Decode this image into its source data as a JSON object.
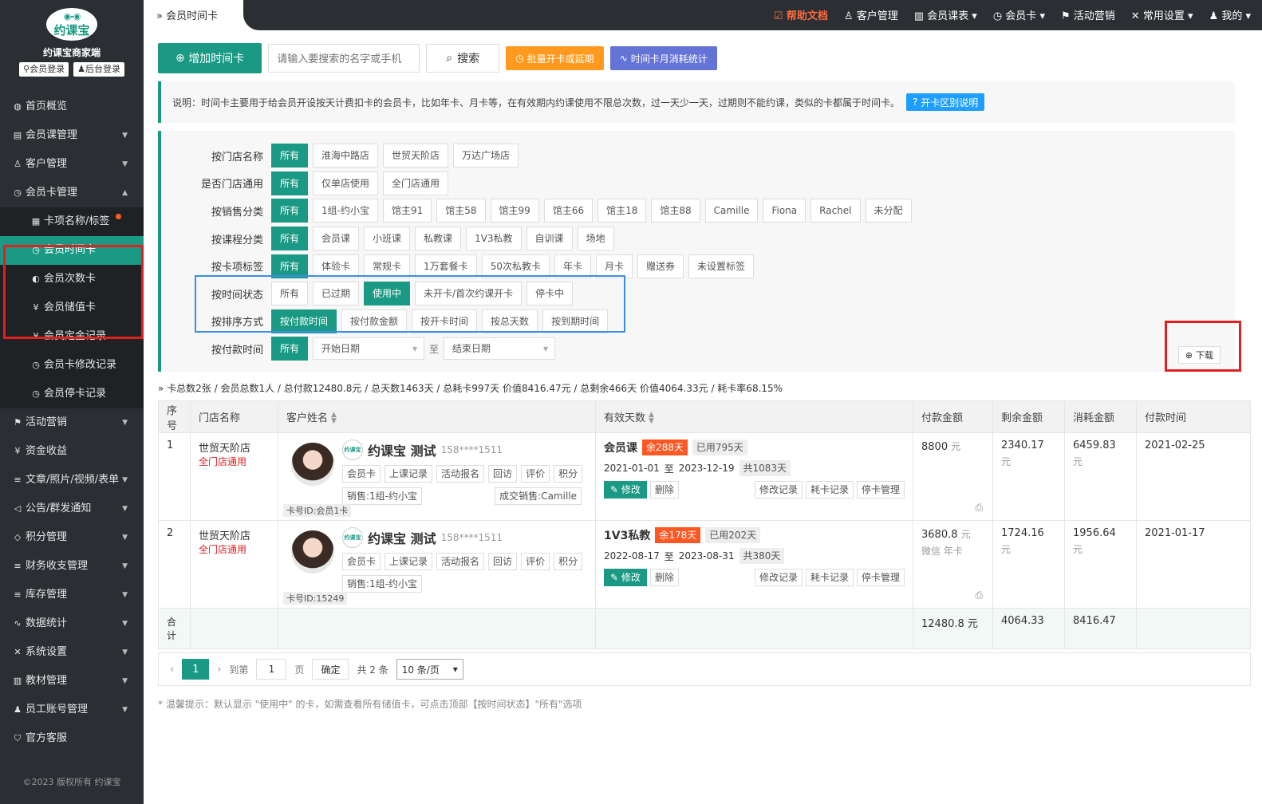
{
  "brand": {
    "logo_text": "约课宝",
    "shop_name": "约课宝商家端",
    "member_login": "会员登录",
    "admin_login": "后台登录"
  },
  "sidebar": {
    "items": [
      {
        "label": "首页概览",
        "icon": "globe-icon"
      },
      {
        "label": "会员课管理",
        "icon": "doc-icon"
      },
      {
        "label": "客户管理",
        "icon": "user-icon"
      },
      {
        "label": "会员卡管理",
        "icon": "clock-icon"
      }
    ],
    "sub": [
      {
        "label": "卡项名称/标签"
      },
      {
        "label": "会员时间卡"
      },
      {
        "label": "会员次数卡"
      },
      {
        "label": "会员储值卡"
      },
      {
        "label": "会员定金记录"
      },
      {
        "label": "会员卡修改记录"
      },
      {
        "label": "会员停卡记录"
      }
    ],
    "more": [
      {
        "label": "活动营销"
      },
      {
        "label": "资金收益"
      },
      {
        "label": "文章/照片/视频/表单"
      },
      {
        "label": "公告/群发通知"
      },
      {
        "label": "积分管理"
      },
      {
        "label": "财务收支管理"
      },
      {
        "label": "库存管理"
      },
      {
        "label": "数据统计"
      },
      {
        "label": "系统设置"
      },
      {
        "label": "教材管理"
      },
      {
        "label": "员工账号管理"
      },
      {
        "label": "官方客服"
      }
    ],
    "copyright": "©2023 版权所有 约课宝"
  },
  "topbar": {
    "breadcrumb": "会员时间卡",
    "menu": [
      "帮助文档",
      "客户管理",
      "会员课表",
      "会员卡",
      "活动营销",
      "常用设置",
      "我的"
    ]
  },
  "toolbar": {
    "add": "增加时间卡",
    "search_placeholder": "请输入要搜索的名字或手机",
    "search": "搜索",
    "batch": "批量开卡或延期",
    "stats": "时间卡月消耗统计"
  },
  "note": {
    "text": "说明：时间卡主要用于给会员开设按天计费扣卡的会员卡，比如年卡、月卡等，在有效期内约课使用不限总次数，过一天少一天，过期则不能约课，类似的卡都属于时间卡。",
    "btn": "开卡区别说明"
  },
  "filters": {
    "store": {
      "label": "按门店名称",
      "opts": [
        "所有",
        "淮海中路店",
        "世贸天阶店",
        "万达广场店"
      ]
    },
    "common": {
      "label": "是否门店通用",
      "opts": [
        "所有",
        "仅单店使用",
        "全门店通用"
      ]
    },
    "sales": {
      "label": "按销售分类",
      "opts": [
        "所有",
        "1组-约小宝",
        "馆主91",
        "馆主58",
        "馆主99",
        "馆主66",
        "馆主18",
        "馆主88",
        "Camille",
        "Fiona",
        "Rachel",
        "未分配"
      ]
    },
    "course": {
      "label": "按课程分类",
      "opts": [
        "所有",
        "会员课",
        "小班课",
        "私教课",
        "1V3私教",
        "自训课",
        "场地"
      ]
    },
    "tags": {
      "label": "按卡项标签",
      "opts": [
        "所有",
        "体验卡",
        "常规卡",
        "1万套餐卡",
        "50次私教卡",
        "年卡",
        "月卡",
        "赠送券",
        "未设置标签"
      ]
    },
    "status": {
      "label": "按时间状态",
      "opts": [
        "所有",
        "已过期",
        "使用中",
        "未开卡/首次约课开卡",
        "停卡中"
      ]
    },
    "sort": {
      "label": "按排序方式",
      "opts": [
        "按付款时间",
        "按付款金额",
        "按开卡时间",
        "按总天数",
        "按到期时间"
      ]
    },
    "paytime": {
      "label": "按付款时间",
      "all": "所有",
      "start": "开始日期",
      "to": "至",
      "end": "结束日期"
    },
    "download": "下载"
  },
  "summary": "卡总数2张 / 会员总数1人 / 总付款12480.8元 / 总天数1463天 / 总耗卡997天 价值8416.47元 / 总剩余466天 价值4064.33元 / 耗卡率68.15%",
  "table": {
    "headers": [
      "序号",
      "门店名称",
      "客户姓名",
      "有效天数",
      "付款金额",
      "剩余金额",
      "消耗金额",
      "付款时间"
    ],
    "rows": [
      {
        "no": "1",
        "store": "世贸天阶店",
        "scope": "全门店通用",
        "name": "约课宝 测试",
        "phone": "158****1511",
        "tags": [
          "会员卡",
          "上课记录",
          "活动报名",
          "回访",
          "评价",
          "积分"
        ],
        "sale": "销售:1组-约小宝",
        "deal": "成交销售:Camille",
        "cardid": "卡号ID:会员1卡",
        "card": "会员课",
        "remain": "余288天",
        "used": "已用795天",
        "start": "2021-01-01",
        "to": "至",
        "end": "2023-12-19",
        "total": "共1083天",
        "edit": "修改",
        "del": "删除",
        "ops": [
          "修改记录",
          "耗卡记录",
          "停卡管理"
        ],
        "pay": "8800",
        "pay_unit": "元",
        "pay_sub": "",
        "left": "2340.17",
        "left_unit": "元",
        "cost": "6459.83",
        "cost_unit": "元",
        "time": "2021-02-25"
      },
      {
        "no": "2",
        "store": "世贸天阶店",
        "scope": "全门店通用",
        "name": "约课宝 测试",
        "phone": "158****1511",
        "tags": [
          "会员卡",
          "上课记录",
          "活动报名",
          "回访",
          "评价",
          "积分"
        ],
        "sale": "销售:1组-约小宝",
        "deal": "",
        "cardid": "卡号ID:15249",
        "card": "1V3私教",
        "remain": "余178天",
        "used": "已用202天",
        "start": "2022-08-17",
        "to": "至",
        "end": "2023-08-31",
        "total": "共380天",
        "edit": "修改",
        "del": "删除",
        "ops": [
          "修改记录",
          "耗卡记录",
          "停卡管理"
        ],
        "pay": "3680.8",
        "pay_unit": "元",
        "pay_sub": "微信 年卡",
        "left": "1724.16",
        "left_unit": "元",
        "cost": "1956.64",
        "cost_unit": "元",
        "time": "2021-01-17"
      }
    ],
    "total": {
      "label": "合计",
      "pay": "12480.8 元",
      "left": "4064.33",
      "cost": "8416.47"
    }
  },
  "pager": {
    "page": "1",
    "goto": "到第",
    "input": "1",
    "page_unit": "页",
    "confirm": "确定",
    "count": "共 2 条",
    "size": "10 条/页"
  },
  "tip": "* 温馨提示：默认显示 \"使用中\" 的卡，如需查看所有储值卡，可点击顶部【按时间状态】\"所有\"选项",
  "colors": {
    "accent": "#1a9a84",
    "sidebar": "#2b2f33",
    "highlight": "#e02020",
    "orange": "#ff9a1f",
    "purple": "#6473d6"
  }
}
